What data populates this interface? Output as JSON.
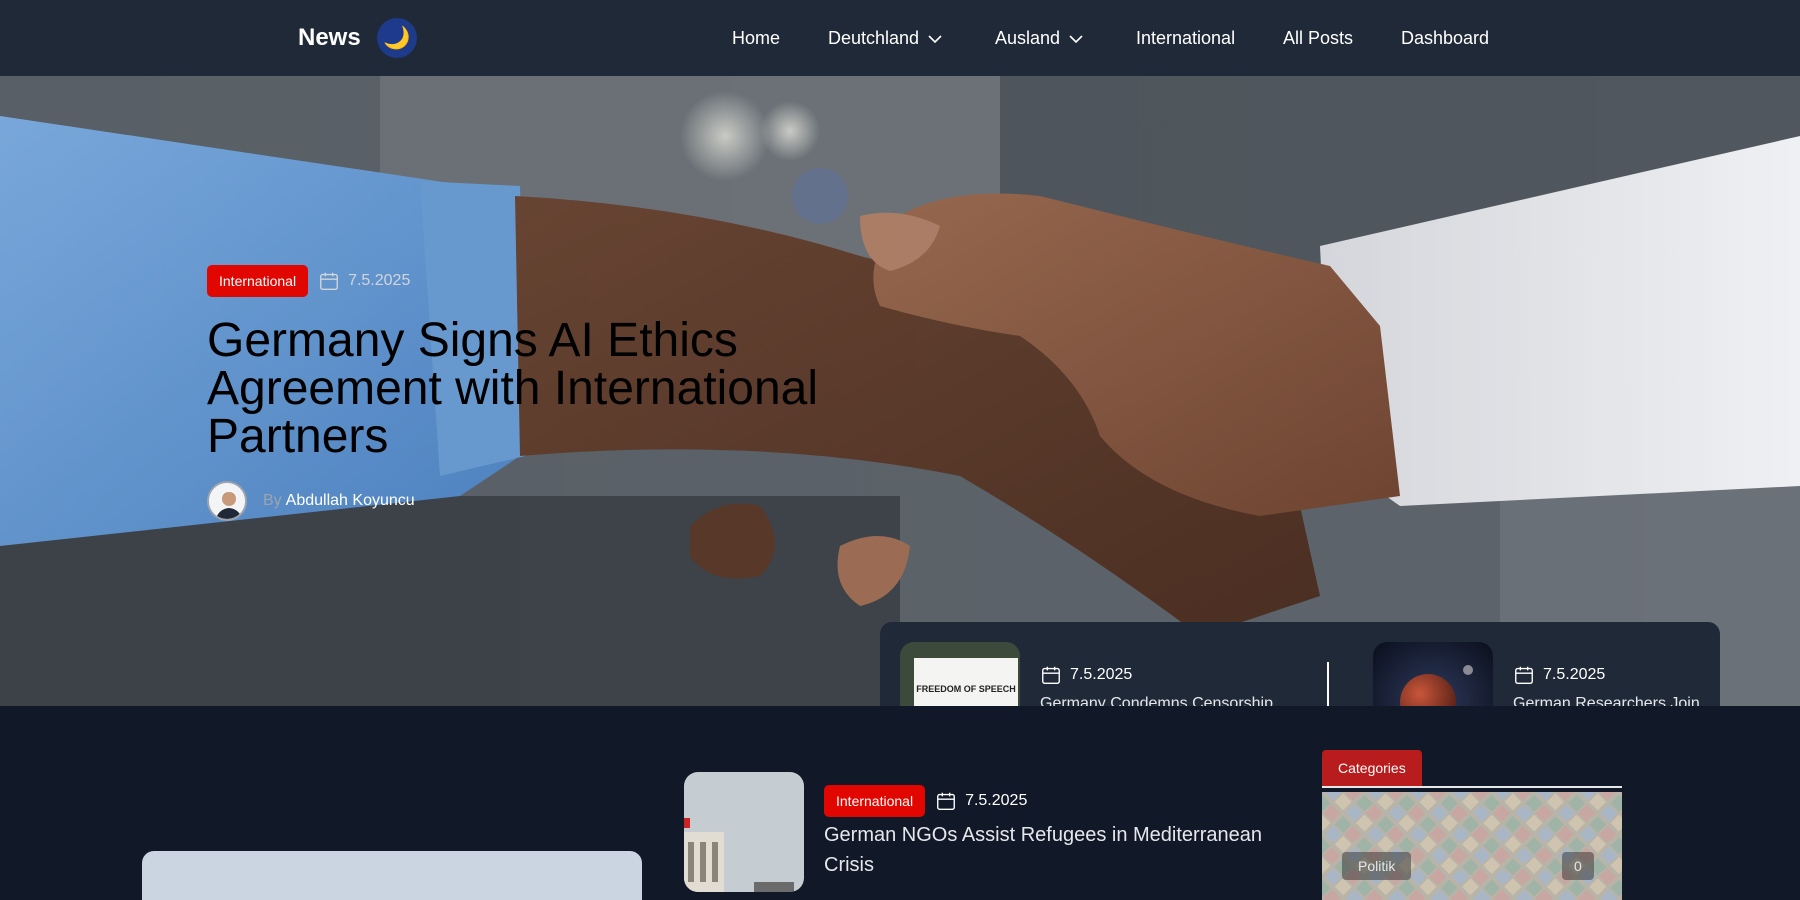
{
  "header": {
    "brand": "News",
    "theme_toggle_icon": "🌙",
    "nav": [
      {
        "label": "Home"
      },
      {
        "label": "Deutchland",
        "dropdown": true
      },
      {
        "label": "Ausland",
        "dropdown": true
      },
      {
        "label": "International"
      },
      {
        "label": "All Posts"
      },
      {
        "label": "Dashboard"
      }
    ]
  },
  "hero": {
    "category": "International",
    "date": "7.5.2025",
    "title": "Germany Signs AI Ethics Agreement with International Partners",
    "by": "By",
    "author": "Abdullah Koyuncu"
  },
  "featured": [
    {
      "date": "7.5.2025",
      "title": "Germany Condemns Censorship in Global Press Freedom Report",
      "image_text": "FREEDOM OF SPEECH"
    },
    {
      "date": "7.5.2025",
      "title": "German Researchers Join International Mars Mission"
    }
  ],
  "post": {
    "category": "International",
    "date": "7.5.2025",
    "title": "German NGOs Assist Refugees in Mediterranean Crisis"
  },
  "sidebar": {
    "tab": "Categories",
    "category": {
      "name": "Politik",
      "count": "0"
    }
  },
  "colors": {
    "accent": "#e10600",
    "header_bg": "#1f2937",
    "page_bg": "#111827",
    "category_tab": "#b91c1c"
  }
}
